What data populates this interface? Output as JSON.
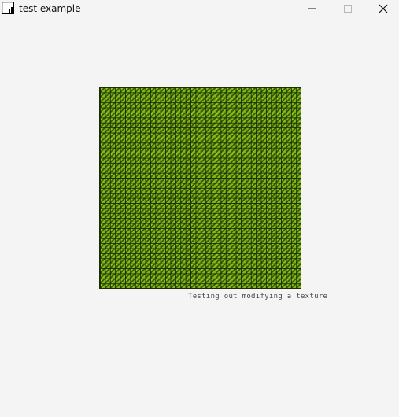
{
  "window": {
    "title": "test example",
    "icon": "app-window-icon",
    "controls": {
      "minimize_icon": "minimize-icon",
      "maximize_icon": "maximize-icon",
      "close_icon": "close-icon"
    }
  },
  "content": {
    "caption": "Testing out modifying a texture",
    "texture_colors": {
      "light_green": "#b6e63a",
      "mid_green": "#8cc21a",
      "dark_green": "#2b4a04",
      "grid_line": "#142004"
    }
  },
  "background_color": "#f4f4f4"
}
